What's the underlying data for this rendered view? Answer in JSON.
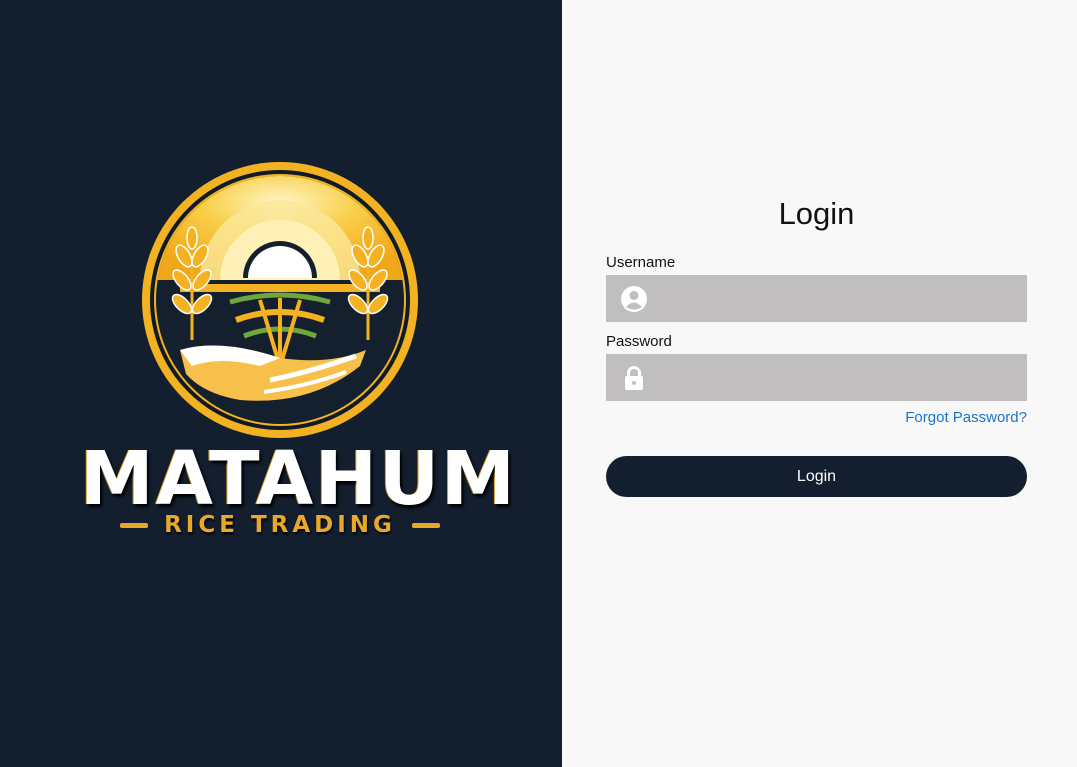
{
  "brand": {
    "name": "MATAHUM",
    "tagline": "RICE TRADING"
  },
  "login": {
    "title": "Login",
    "username_label": "Username",
    "username_value": "",
    "username_placeholder": "",
    "password_label": "Password",
    "password_value": "",
    "password_placeholder": "",
    "forgot_password": "Forgot Password?",
    "submit_label": "Login"
  },
  "icons": {
    "username": "user-circle-icon",
    "password": "lock-icon"
  },
  "colors": {
    "left_background": "#131f2f",
    "right_background": "#f8f8f8",
    "input_background": "#c1bebf",
    "link": "#1a73c8",
    "button": "#131f2f",
    "brand_gold": "#e8a92a"
  }
}
